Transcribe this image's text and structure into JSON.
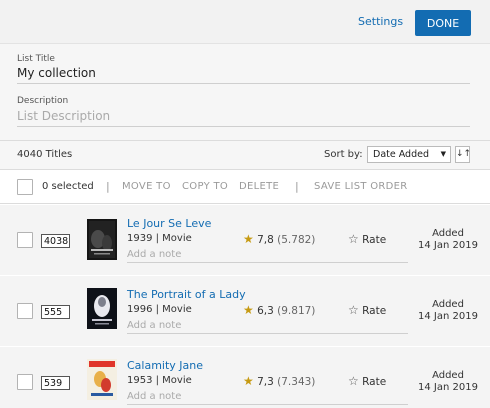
{
  "header": {
    "settings_label": "Settings",
    "done_label": "DONE"
  },
  "form": {
    "title_label": "List Title",
    "title_value": "My collection",
    "description_label": "Description",
    "description_placeholder": "List Description"
  },
  "list_bar": {
    "count": "4040 Titles",
    "sort_label": "Sort by:",
    "sort_value": "Date Added",
    "sort_direction_icon": "sort-direction-icon"
  },
  "actions": {
    "selected": "0 selected",
    "move_to": "MOVE TO",
    "copy_to": "COPY TO",
    "delete": "DELETE",
    "save_order": "SAVE LIST ORDER",
    "separator": "|"
  },
  "items": [
    {
      "position": "4038",
      "title": "Le Jour Se Leve",
      "meta": "1939 | Movie",
      "rating": "7,8",
      "votes": "(5.782)",
      "rate_label": "Rate",
      "note_placeholder": "Add a note",
      "added_label": "Added",
      "added_date": "14 Jan 2019"
    },
    {
      "position": "555",
      "title": "The Portrait of a Lady",
      "meta": "1996 | Movie",
      "rating": "6,3",
      "votes": "(9.817)",
      "rate_label": "Rate",
      "note_placeholder": "Add a note",
      "added_label": "Added",
      "added_date": "14 Jan 2019"
    },
    {
      "position": "539",
      "title": "Calamity Jane",
      "meta": "1953 | Movie",
      "rating": "7,3",
      "votes": "(7.343)",
      "rate_label": "Rate",
      "note_placeholder": "Add a note",
      "added_label": "Added",
      "added_date": "14 Jan 2019"
    }
  ],
  "colors": {
    "accent": "#136cb2",
    "star": "#c69a12"
  }
}
